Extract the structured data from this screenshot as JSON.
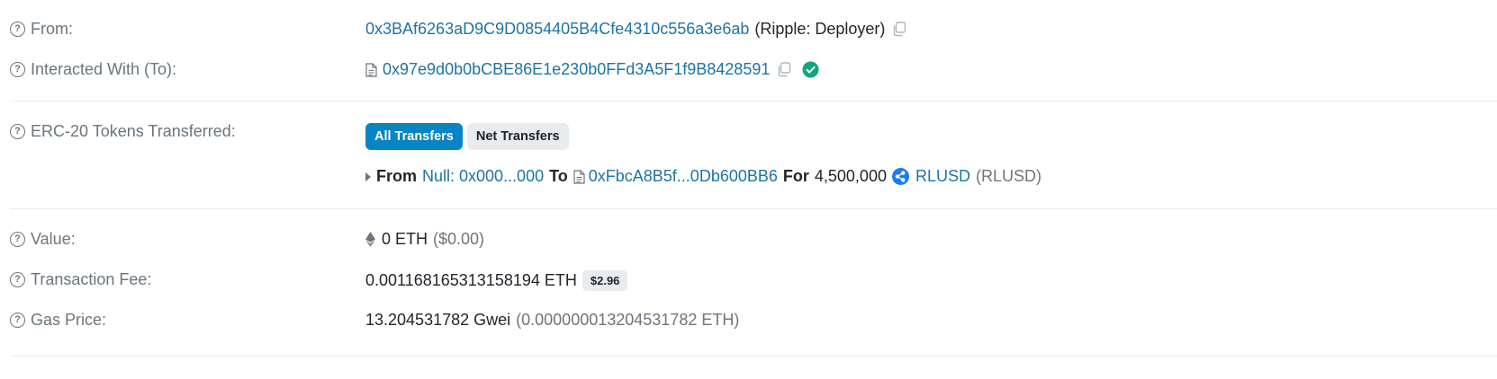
{
  "rows": {
    "from": {
      "label": "From:",
      "address": "0x3BAf6263aD9C9D0854405B4Cfe4310c556a3e6ab",
      "name_tag": "(Ripple: Deployer)"
    },
    "interacted": {
      "label": "Interacted With (To):",
      "address": "0x97e9d0b0bCBE86E1e230b0FFd3A5F1f9B8428591"
    },
    "erc20": {
      "label": "ERC-20 Tokens Transferred:",
      "tabs": [
        "All Transfers",
        "Net Transfers"
      ],
      "transfer": {
        "from_word": "From",
        "from_value": "Null: 0x000...000",
        "to_word": "To",
        "to_value": "0xFbcA8B5f...0Db600BB6",
        "for_word": "For",
        "amount": "4,500,000",
        "token_name": "RLUSD",
        "token_symbol": "(RLUSD)"
      }
    },
    "value": {
      "label": "Value:",
      "amount": "0 ETH",
      "usd": "($0.00)"
    },
    "fee": {
      "label": "Transaction Fee:",
      "amount": "0.001168165313158194 ETH",
      "usd_badge": "$2.96"
    },
    "gas": {
      "label": "Gas Price:",
      "gwei": "13.204531782 Gwei",
      "eth": "(0.000000013204531782 ETH)"
    }
  },
  "colors": {
    "link": "#1e73a5",
    "primary_button": "#0784c3",
    "verified": "#0fa67e",
    "token_icon": "#1a7cf5"
  },
  "icons": {
    "help": "question-circle-icon",
    "copy": "copy-icon",
    "contract": "document-icon",
    "verified": "check-circle-icon",
    "eth": "ethereum-icon",
    "token": "ripple-icon"
  }
}
